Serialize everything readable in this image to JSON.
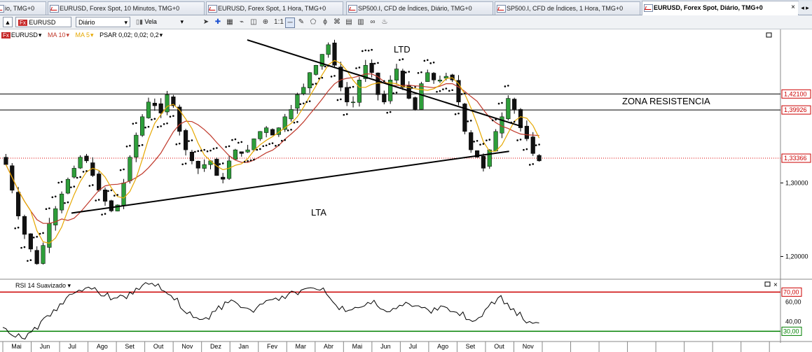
{
  "tabs": [
    {
      "label": "io, TMG+0",
      "active": false
    },
    {
      "label": "EURUSD, Forex Spot, 10 Minutos, TMG+0",
      "active": false
    },
    {
      "label": "EURUSD, Forex Spot, 1 Hora, TMG+0",
      "active": false
    },
    {
      "label": "SP500.I, CFD de Índices, Diário, TMG+0",
      "active": false
    },
    {
      "label": "SP500.I, CFD de Índices, 1 Hora, TMG+0",
      "active": false
    },
    {
      "label": "EURUSD, Forex Spot, Diário, TMG+0",
      "active": true,
      "close": "×"
    }
  ],
  "toolbar": {
    "symbol": "EURUSD",
    "symbol_badge": "Fx",
    "timeframe": "Diário",
    "chart_type": "Vela",
    "icons": [
      "cursor-icon",
      "crosshair-icon",
      "grid-icon",
      "wave-icon",
      "zoom-box-icon",
      "zoom-in-icon",
      "one-to-one-icon",
      "line-tool-icon",
      "pencil-icon",
      "shapes-icon",
      "fib-icon",
      "pattern-icon",
      "template-icon",
      "template2-icon",
      "link-icon",
      "alert-icon"
    ]
  },
  "indicators_bar": {
    "symbol": "EURUSD",
    "ma10": "MA 10",
    "ma5": "MA 5",
    "psar": "PSAR 0,02; 0,02; 0,2"
  },
  "chart_data": {
    "type": "candlestick",
    "symbol": "EURUSD",
    "annotations": {
      "ltd": "LTD",
      "lta": "LTA",
      "zona": "ZONA RESISTENCIA"
    },
    "price_axis": {
      "ticks": [
        "1,30000",
        "1,20000"
      ],
      "tick_values": [
        1.3,
        1.2
      ],
      "ylim": [
        1.17,
        1.505
      ]
    },
    "price_labels": [
      {
        "text": "1,42100",
        "value": 1.421,
        "color": "#cc0000"
      },
      {
        "text": "1,39926",
        "value": 1.39926,
        "color": "#cc0000"
      },
      {
        "text": "1,33366",
        "value": 1.33366,
        "color": "#cc0000"
      }
    ],
    "horizontal_lines": [
      1.421,
      1.39926
    ],
    "current_price": 1.33366,
    "months": [
      "Mai",
      "Jun",
      "Jul",
      "Ago",
      "Set",
      "Out",
      "Nov",
      "Dez",
      "Jan",
      "Fev",
      "Mar",
      "Abr",
      "Mai",
      "Jun",
      "Jul",
      "Ago",
      "Set",
      "Out",
      "Nov"
    ],
    "series_close": [
      1.325,
      1.29,
      1.255,
      1.23,
      1.21,
      1.19,
      1.215,
      1.245,
      1.265,
      1.285,
      1.305,
      1.32,
      1.335,
      1.33,
      1.31,
      1.29,
      1.275,
      1.262,
      1.27,
      1.3,
      1.335,
      1.365,
      1.39,
      1.41,
      1.405,
      1.395,
      1.42,
      1.405,
      1.37,
      1.345,
      1.33,
      1.32,
      1.325,
      1.33,
      1.31,
      1.305,
      1.33,
      1.345,
      1.34,
      1.345,
      1.36,
      1.37,
      1.375,
      1.365,
      1.375,
      1.39,
      1.4,
      1.42,
      1.43,
      1.45,
      1.46,
      1.475,
      1.488,
      1.46,
      1.43,
      1.41,
      1.41,
      1.44,
      1.46,
      1.45,
      1.42,
      1.41,
      1.44,
      1.455,
      1.43,
      1.415,
      1.4,
      1.435,
      1.45,
      1.44,
      1.44,
      1.445,
      1.44,
      1.41,
      1.37,
      1.345,
      1.335,
      1.32,
      1.345,
      1.37,
      1.39,
      1.415,
      1.4,
      1.375,
      1.36,
      1.34,
      1.33
    ],
    "lines": {
      "ltd": [
        [
          0.3045,
          1.4945
        ],
        [
          0.6435,
          1.3765
        ]
      ],
      "lta": [
        [
          0.088,
          1.259
        ],
        [
          0.627,
          1.343
        ]
      ]
    },
    "rsi": {
      "label": "RSI 14 Suavizado",
      "levels": [
        {
          "text": "70,00",
          "value": 70,
          "color": "#cc0000"
        },
        {
          "text": "30,00",
          "value": 30,
          "color": "#008000"
        }
      ],
      "ticks": [
        "60,00",
        "40,00"
      ],
      "tick_values": [
        60,
        40
      ],
      "ylim": [
        21,
        81
      ],
      "values": [
        34,
        28,
        24,
        23,
        28,
        34,
        40,
        46,
        52,
        58,
        64,
        68,
        72,
        74,
        73,
        70,
        66,
        62,
        64,
        66,
        70,
        74,
        77,
        78,
        76,
        72,
        68,
        62,
        54,
        48,
        44,
        42,
        44,
        50,
        56,
        60,
        62,
        58,
        54,
        52,
        54,
        58,
        62,
        64,
        66,
        68,
        70,
        72,
        74,
        74,
        72,
        68,
        60,
        52,
        50,
        52,
        54,
        56,
        58,
        56,
        52,
        50,
        53,
        56,
        58,
        56,
        54,
        52,
        54,
        56,
        54,
        50,
        46,
        42,
        40,
        44,
        52,
        60,
        64,
        58,
        52,
        46,
        42,
        40,
        39
      ]
    },
    "x_months_days": []
  }
}
